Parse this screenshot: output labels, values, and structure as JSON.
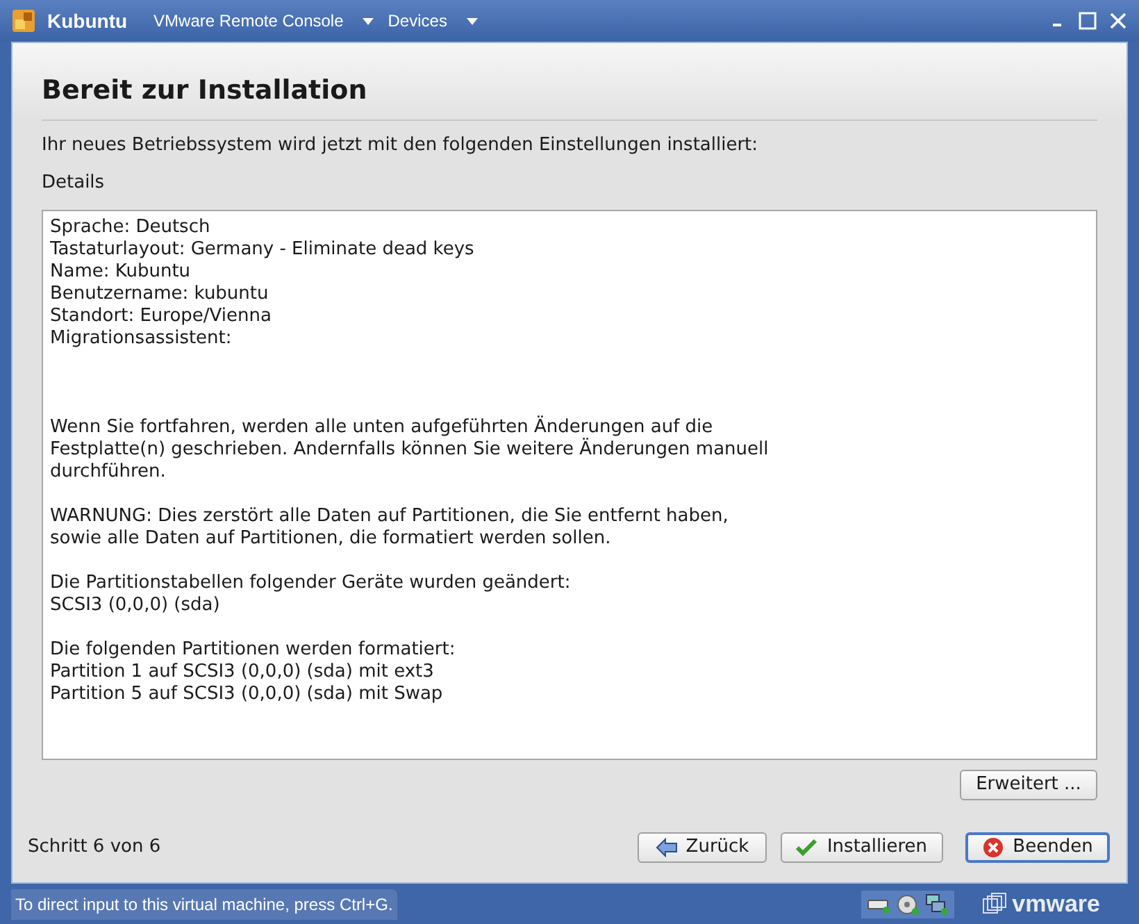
{
  "window": {
    "title": "Kubuntu",
    "menus": [
      {
        "label": "VMware Remote Console"
      },
      {
        "label": "Devices"
      }
    ]
  },
  "heading": "Bereit zur Installation",
  "intro": "Ihr neues Betriebssystem wird jetzt mit den folgenden Einstellungen installiert:",
  "details_label": "Details",
  "details": [
    {
      "lines": [
        "Sprache: Deutsch",
        "Tastaturlayout: Germany - Eliminate dead keys",
        "Name: Kubuntu",
        "Benutzername: kubuntu",
        "Standort: Europe/Vienna",
        "Migrationsassistent:"
      ]
    },
    {
      "lines": [
        "Wenn Sie fortfahren, werden alle unten aufgeführten Änderungen auf die",
        "Festplatte(n) geschrieben. Andernfalls können Sie weitere Änderungen manuell",
        "durchführen."
      ]
    },
    {
      "lines": [
        "WARNUNG: Dies zerstört alle Daten auf Partitionen, die Sie entfernt haben,",
        "sowie alle Daten auf Partitionen, die formatiert werden sollen."
      ]
    },
    {
      "lines": [
        "Die Partitionstabellen folgender Geräte wurden geändert:",
        "SCSI3 (0,0,0) (sda)"
      ]
    },
    {
      "lines": [
        "Die folgenden Partitionen werden formatiert:",
        "Partition 1 auf SCSI3 (0,0,0) (sda) mit ext3",
        "Partition 5 auf SCSI3 (0,0,0) (sda) mit Swap"
      ]
    }
  ],
  "advanced_button": "Erweitert ...",
  "step": "Schritt 6 von 6",
  "buttons": [
    {
      "kind": "back",
      "label": "Zurück",
      "selected": false
    },
    {
      "kind": "install",
      "label": "Installieren",
      "selected": false
    },
    {
      "kind": "quit",
      "label": "Beenden",
      "selected": true
    }
  ],
  "status_bar": {
    "hint": "To direct input to this virtual machine, press Ctrl+G.",
    "logo_text": "vmware"
  }
}
